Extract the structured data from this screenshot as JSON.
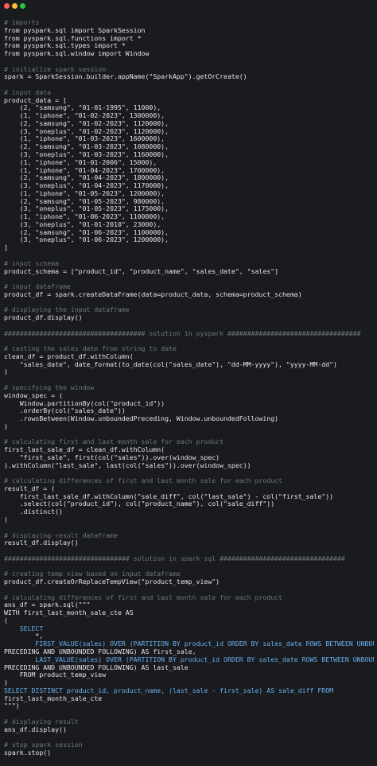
{
  "window": {
    "buttons": {
      "close_color": "#ff5f56",
      "minimize_color": "#ffbd2e",
      "maximize_color": "#27c93f"
    }
  },
  "theme": {
    "background": "#1a1b1e",
    "text": "#e6e6e6",
    "comment": "#6e7681",
    "keyword": "#6ab0f3"
  },
  "code": {
    "lines": [
      {
        "kind": "c",
        "text": "# imports"
      },
      {
        "kind": "t",
        "text": "from pyspark.sql import SparkSession"
      },
      {
        "kind": "t",
        "text": "from pyspark.sql.functions import *"
      },
      {
        "kind": "t",
        "text": "from pyspark.sql.types import *"
      },
      {
        "kind": "t",
        "text": "from pyspark.sql.window import Window"
      },
      {
        "kind": "t",
        "text": ""
      },
      {
        "kind": "c",
        "text": "# initialize spark session"
      },
      {
        "kind": "t",
        "text": "spark = SparkSession.builder.appName(\"SparkApp\").getOrCreate()"
      },
      {
        "kind": "t",
        "text": ""
      },
      {
        "kind": "c",
        "text": "# input data"
      },
      {
        "kind": "t",
        "text": "product_data = ["
      },
      {
        "kind": "t",
        "text": "    (2, \"samsung\", \"01-01-1995\", 11000),"
      },
      {
        "kind": "t",
        "text": "    (1, \"iphone\", \"01-02-2023\", 1300000),"
      },
      {
        "kind": "t",
        "text": "    (2, \"samsung\", \"01-02-2023\", 1120000),"
      },
      {
        "kind": "t",
        "text": "    (3, \"oneplus\", \"01-02-2023\", 1120000),"
      },
      {
        "kind": "t",
        "text": "    (1, \"iphone\", \"01-03-2023\", 1600000),"
      },
      {
        "kind": "t",
        "text": "    (2, \"samsung\", \"01-03-2023\", 1080000),"
      },
      {
        "kind": "t",
        "text": "    (3, \"oneplus\", \"01-03-2023\", 1160000),"
      },
      {
        "kind": "t",
        "text": "    (1, \"iphone\", \"01-01-2006\", 15000),"
      },
      {
        "kind": "t",
        "text": "    (1, \"iphone\", \"01-04-2023\", 1700000),"
      },
      {
        "kind": "t",
        "text": "    (2, \"samsung\", \"01-04-2023\", 1800000),"
      },
      {
        "kind": "t",
        "text": "    (3, \"oneplus\", \"01-04-2023\", 1170000),"
      },
      {
        "kind": "t",
        "text": "    (1, \"iphone\", \"01-05-2023\", 1200000),"
      },
      {
        "kind": "t",
        "text": "    (2, \"samsung\", \"01-05-2023\", 980000),"
      },
      {
        "kind": "t",
        "text": "    (3, \"oneplus\", \"01-05-2023\", 1175000),"
      },
      {
        "kind": "t",
        "text": "    (1, \"iphone\", \"01-06-2023\", 1100000),"
      },
      {
        "kind": "t",
        "text": "    (3, \"oneplus\", \"01-01-2010\", 23000),"
      },
      {
        "kind": "t",
        "text": "    (2, \"samsung\", \"01-06-2023\", 1100000),"
      },
      {
        "kind": "t",
        "text": "    (3, \"oneplus\", \"01-06-2023\", 1200000),"
      },
      {
        "kind": "t",
        "text": "]"
      },
      {
        "kind": "t",
        "text": ""
      },
      {
        "kind": "c",
        "text": "# input schema"
      },
      {
        "kind": "t",
        "text": "product_schema = [\"product_id\", \"product_name\", \"sales_date\", \"sales\"]"
      },
      {
        "kind": "t",
        "text": ""
      },
      {
        "kind": "c",
        "text": "# input dataframe"
      },
      {
        "kind": "t",
        "text": "product_df = spark.createDataFrame(data=product_data, schema=product_schema)"
      },
      {
        "kind": "t",
        "text": ""
      },
      {
        "kind": "c",
        "text": "# displaying the input dataframe"
      },
      {
        "kind": "t",
        "text": "product_df.display()"
      },
      {
        "kind": "t",
        "text": ""
      },
      {
        "kind": "c",
        "text": "#################################### solution in pyspark ##################################"
      },
      {
        "kind": "t",
        "text": ""
      },
      {
        "kind": "c",
        "text": "# casting the sales date from string to date"
      },
      {
        "kind": "t",
        "text": "clean_df = product_df.withColumn("
      },
      {
        "kind": "t",
        "text": "    \"sales_date\", date_format(to_date(col(\"sales_date\"), \"dd-MM-yyyy\"), \"yyyy-MM-dd\")"
      },
      {
        "kind": "t",
        "text": ")"
      },
      {
        "kind": "t",
        "text": ""
      },
      {
        "kind": "c",
        "text": "# specifying the window"
      },
      {
        "kind": "t",
        "text": "window_spec = ("
      },
      {
        "kind": "t",
        "text": "    Window.partitionBy(col(\"product_id\"))"
      },
      {
        "kind": "t",
        "text": "    .orderBy(col(\"sales_date\"))"
      },
      {
        "kind": "t",
        "text": "    .rowsBetween(Window.unboundedPreceding, Window.unboundedFollowing)"
      },
      {
        "kind": "t",
        "text": ")"
      },
      {
        "kind": "t",
        "text": ""
      },
      {
        "kind": "c",
        "text": "# calculating first and last month sale for each product"
      },
      {
        "kind": "t",
        "text": "first_last_sale_df = clean_df.withColumn("
      },
      {
        "kind": "t",
        "text": "    \"first_sale\", first(col(\"sales\")).over(window_spec)"
      },
      {
        "kind": "t",
        "text": ").withColumn(\"last_sale\", last(col(\"sales\")).over(window_spec))"
      },
      {
        "kind": "t",
        "text": ""
      },
      {
        "kind": "c",
        "text": "# calculating differences of first and last month sale for each product"
      },
      {
        "kind": "t",
        "text": "result_df = ("
      },
      {
        "kind": "t",
        "text": "    first_last_sale_df.withColumn(\"sale_diff\", col(\"last_sale\") - col(\"first_sale\"))"
      },
      {
        "kind": "t",
        "text": "    .select(col(\"product_id\"), col(\"product_name\"), col(\"sale_diff\"))"
      },
      {
        "kind": "t",
        "text": "    .distinct()"
      },
      {
        "kind": "t",
        "text": ")"
      },
      {
        "kind": "t",
        "text": ""
      },
      {
        "kind": "c",
        "text": "# displaying result dataframe"
      },
      {
        "kind": "t",
        "text": "result_df.display()"
      },
      {
        "kind": "t",
        "text": ""
      },
      {
        "kind": "c",
        "text": "################################ solution in spark sql ################################"
      },
      {
        "kind": "t",
        "text": ""
      },
      {
        "kind": "c",
        "text": "# creating temp view based on input dataframe"
      },
      {
        "kind": "t",
        "text": "product_df.createOrReplaceTempView(\"product_temp_view\")"
      },
      {
        "kind": "t",
        "text": ""
      },
      {
        "kind": "c",
        "text": "# calculating differences of first and last month sale for each product"
      },
      {
        "kind": "t",
        "text": "ans_df = spark.sql(\"\"\""
      },
      {
        "kind": "t",
        "text": "WITH first_last_month_sale_cte AS"
      },
      {
        "kind": "t",
        "text": "("
      },
      {
        "kind": "k",
        "text": "    SELECT"
      },
      {
        "kind": "t",
        "text": "        *,"
      },
      {
        "kind": "k",
        "text": "        FIRST_VALUE(sales) OVER (PARTITION BY product_id ORDER BY sales_date ROWS BETWEEN UNBOUNDED"
      },
      {
        "kind": "t",
        "text": "PRECEDING AND UNBOUNDED FOLLOWING) AS first_sale,"
      },
      {
        "kind": "k",
        "text": "        LAST_VALUE(sales) OVER (PARTITION BY product_id ORDER BY sales_date ROWS BETWEEN UNBOUNDED"
      },
      {
        "kind": "t",
        "text": "PRECEDING AND UNBOUNDED FOLLOWING) AS last_sale"
      },
      {
        "kind": "t",
        "text": "    FROM product_temp_view"
      },
      {
        "kind": "t",
        "text": ")"
      },
      {
        "kind": "k",
        "text": "SELECT DISTINCT product_id, product_name, (last_sale - first_sale) AS sale_diff FROM"
      },
      {
        "kind": "t",
        "text": "first_last_month_sale_cte"
      },
      {
        "kind": "t",
        "text": "\"\"\")"
      },
      {
        "kind": "t",
        "text": ""
      },
      {
        "kind": "c",
        "text": "# displaying result"
      },
      {
        "kind": "t",
        "text": "ans_df.display()"
      },
      {
        "kind": "t",
        "text": ""
      },
      {
        "kind": "c",
        "text": "# stop spark session"
      },
      {
        "kind": "t",
        "text": "spark.stop()"
      }
    ]
  }
}
